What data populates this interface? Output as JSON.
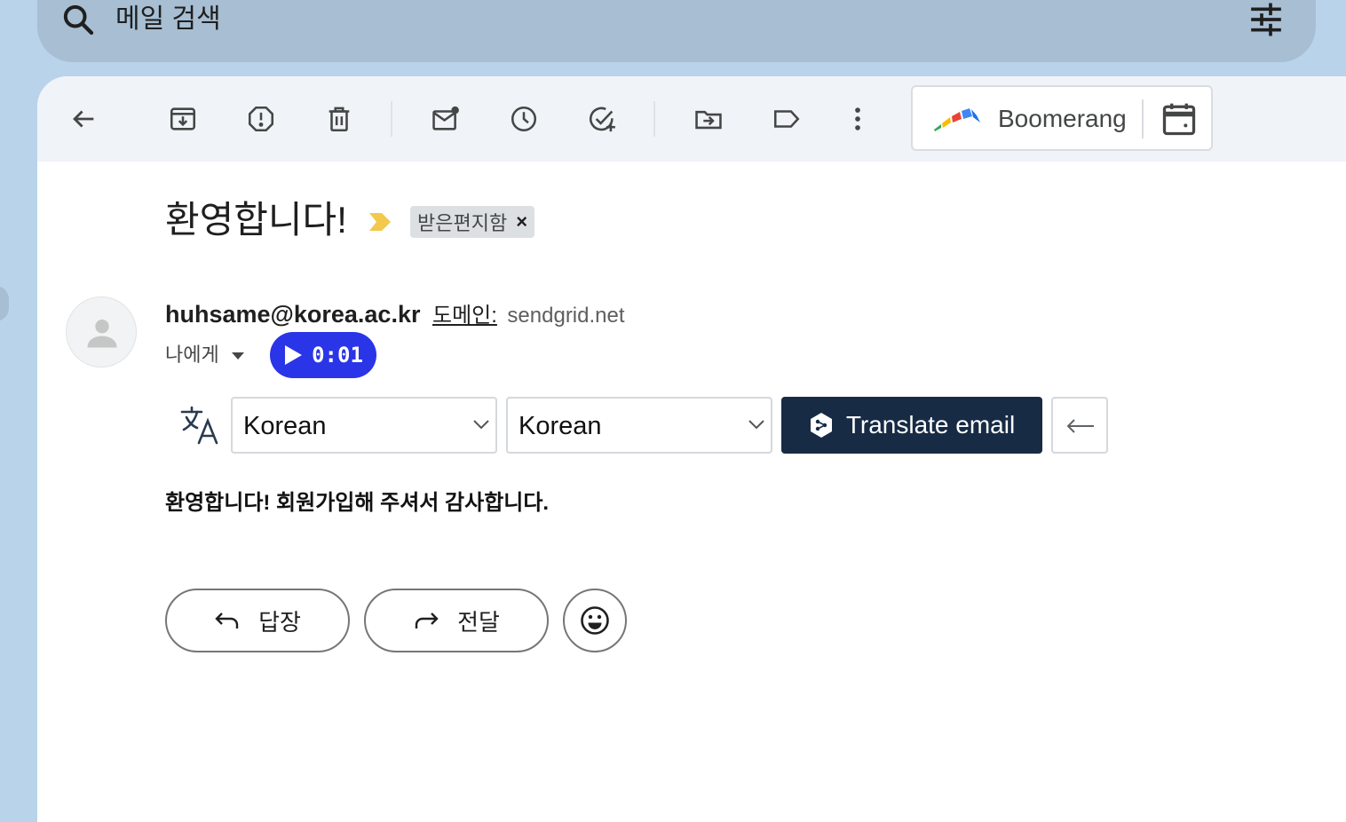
{
  "search": {
    "placeholder": "메일 검색"
  },
  "toolbar": {
    "icons": [
      "back-arrow-icon",
      "archive-icon",
      "report-spam-icon",
      "delete-icon",
      "mark-unread-icon",
      "snooze-icon",
      "add-task-icon",
      "move-to-icon",
      "label-icon",
      "more-vert-icon"
    ]
  },
  "boomerang": {
    "label": "Boomerang"
  },
  "message": {
    "subject": "환영합니다!",
    "label_chip": "받은편지함",
    "label_close": "×",
    "sender_email": "huhsame@korea.ac.kr",
    "domain_label": "도메인:",
    "domain_value": "sendgrid.net",
    "to_label": "나에게",
    "audio_time": "0:01",
    "body": "환영합니다! 회원가입해 주셔서 감사합니다."
  },
  "translate": {
    "source_lang": "Korean",
    "target_lang": "Korean",
    "button_label": "Translate email"
  },
  "actions": {
    "reply_label": "답장",
    "forward_label": "전달"
  },
  "colors": {
    "background": "#b9d3ea",
    "search_bar": "#a7bed3",
    "toolbar": "#f0f4f9",
    "audio_button": "#2a35e8",
    "translate_button": "#172b45",
    "importance_marker": "#f2c94c"
  }
}
